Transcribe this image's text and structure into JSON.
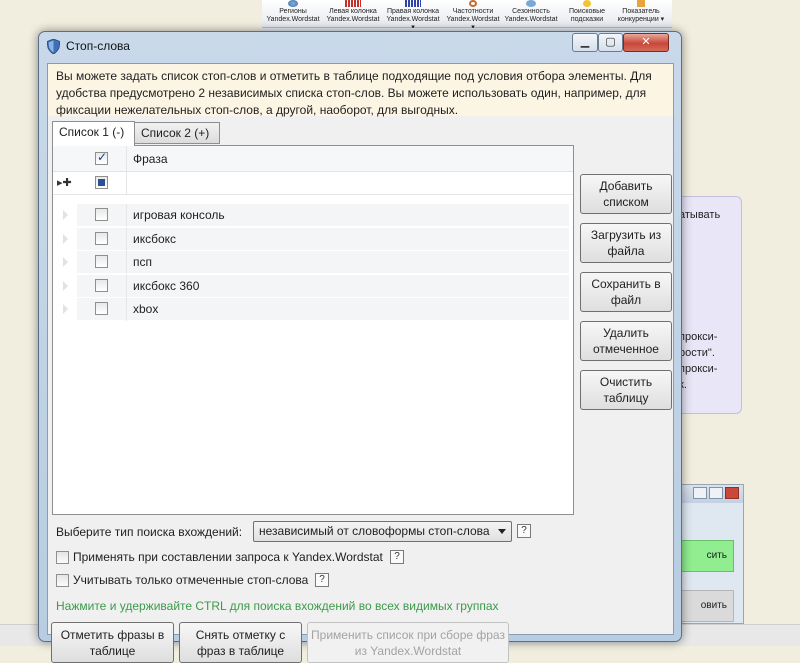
{
  "background": {
    "ribbon": [
      {
        "label": "Регионы\nYandex.Wordstat",
        "icon": "globe-icon"
      },
      {
        "label": "Левая колонка\nYandex.Wordstat",
        "icon": "columns-red-icon"
      },
      {
        "label": "Правая колонка\nYandex.Wordstat ▾",
        "icon": "columns-blue-icon"
      },
      {
        "label": "Частотности\nYandex.Wordstat ▾",
        "icon": "magnifier-icon"
      },
      {
        "label": "Сезонность\nYandex.Wordstat",
        "icon": "season-icon"
      },
      {
        "label": "Поисковые\nподсказки",
        "icon": "hint-icon"
      },
      {
        "label": "Показатель\nконкуренции ▾",
        "icon": "competition-icon"
      }
    ],
    "side_panel_lines": [
      "атывать",
      "прокси-",
      "рости\".",
      "прокси-",
      "к."
    ],
    "green_button": "сить",
    "gray_button": "овить"
  },
  "dialog": {
    "title": "Стоп-слова",
    "title_icon": "shield-icon",
    "info_text": "Вы можете задать список стоп-слов и отметить в таблице подходящие под условия отбора элементы. Для удобства предусмотрено 2 независимых списка стоп-слов. Вы можете использовать один, например, для фиксации нежелательных стоп-слов, а другой, наоборот, для выгодных.",
    "tabs": [
      {
        "label": "Список 1 (-)",
        "active": true
      },
      {
        "label": "Список 2 (+)",
        "active": false
      }
    ],
    "grid": {
      "header_phrase": "Фраза",
      "header_checked": true,
      "rows": [
        {
          "phrase": "игровая консоль",
          "checked": false
        },
        {
          "phrase": "иксбокс",
          "checked": false
        },
        {
          "phrase": "псп",
          "checked": false
        },
        {
          "phrase": "иксбокс 360",
          "checked": false
        },
        {
          "phrase": "xbox",
          "checked": false
        }
      ]
    },
    "side_buttons": {
      "add": "Добавить списком",
      "load": "Загрузить из файла",
      "save": "Сохранить в файл",
      "delete": "Удалить отмеченное",
      "clear": "Очистить таблицу"
    },
    "search_type_label": "Выберите тип поиска вхождений:",
    "search_type_value": "независимый от словоформы стоп-слова",
    "option_wordstat": "Применять при составлении запроса к Yandex.Wordstat",
    "option_only_checked": "Учитывать только отмеченные стоп-слова",
    "help_glyph": "?",
    "hint": "Нажмите и удерживайте CTRL для поиска вхождений во всех видимых группах",
    "bottom_buttons": {
      "mark": "Отметить фразы в таблице",
      "unmark": "Снять отметку с фраз в таблице",
      "apply": "Применить список при сборе фраз из Yandex.Wordstat"
    },
    "colors": {
      "hint": "#3c9a4a",
      "info_bg": "#fdf5e4",
      "close_button": "#c8473a"
    }
  }
}
